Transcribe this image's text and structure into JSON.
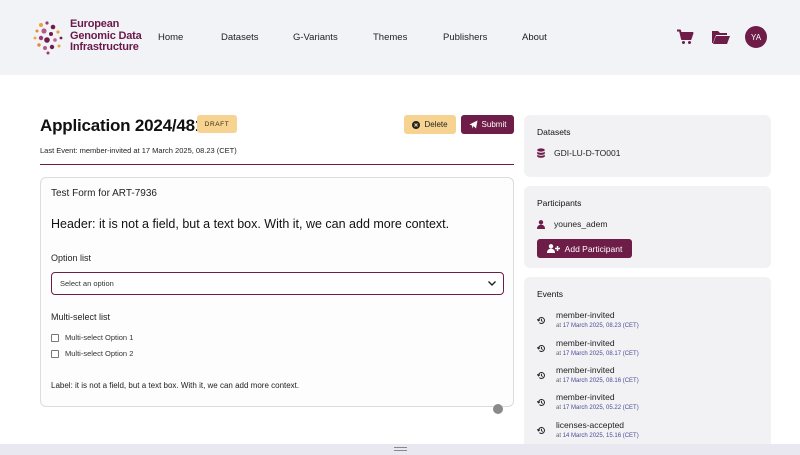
{
  "brand": {
    "line1": "European",
    "line2": "Genomic Data",
    "line3": "Infrastructure"
  },
  "nav": {
    "home": "Home",
    "datasets": "Datasets",
    "gvariants": "G-Variants",
    "themes": "Themes",
    "publishers": "Publishers",
    "about": "About"
  },
  "user": {
    "initials": "YA"
  },
  "application": {
    "title": "Application 2024/481",
    "status": "DRAFT",
    "delete_label": "Delete",
    "submit_label": "Submit",
    "last_event": "Last Event: member-invited at 17 March 2025, 08.23 (CET)"
  },
  "form": {
    "title": "Test Form for ART-7936",
    "header": "Header: it is not a field, but a text box. With it, we can add more context.",
    "option_list_label": "Option list",
    "select_placeholder": "Select an option",
    "multi_select_label": "Multi-select list",
    "options": [
      "Multi-select Option 1",
      "Multi-select Option 2"
    ],
    "footer_label": "Label: it is not a field, but a text box. With it, we can add more context."
  },
  "sidebar": {
    "datasets_title": "Datasets",
    "dataset": "GDI-LU-D-TO001",
    "participants_title": "Participants",
    "participant": "younes_adem",
    "add_participant_label": "Add Participant",
    "events_title": "Events",
    "events": [
      {
        "name": "member-invited",
        "time": "17 March 2025, 08.23 (CET)"
      },
      {
        "name": "member-invited",
        "time": "17 March 2025, 08.17 (CET)"
      },
      {
        "name": "member-invited",
        "time": "17 March 2025, 08.16 (CET)"
      },
      {
        "name": "member-invited",
        "time": "17 March 2025, 05.22 (CET)"
      },
      {
        "name": "licenses-accepted",
        "time": "14 March 2025, 15.16 (CET)"
      }
    ],
    "event_at": "at"
  },
  "colors": {
    "brand": "#6e1c48",
    "badge": "#f7d391",
    "panel": "#f2f2f4"
  }
}
